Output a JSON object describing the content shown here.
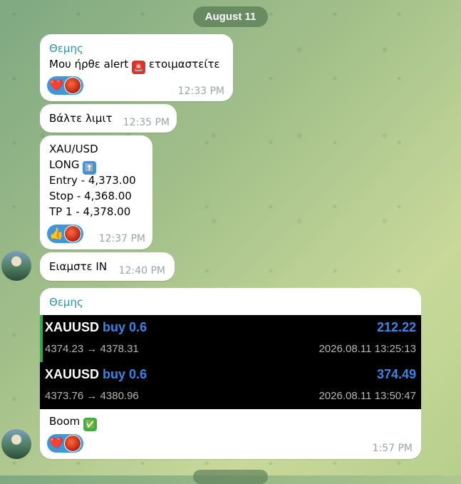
{
  "date_pill": "August 11",
  "messages": {
    "m1": {
      "sender": "Θεμης",
      "text_before": "Μου ήρθε alert",
      "emoji": "🚨",
      "text_after": "ετοιμαστείτε",
      "time": "12:33 PM",
      "reaction": "❤️"
    },
    "m2": {
      "text": "Βάλτε λιμιτ",
      "time": "12:35 PM"
    },
    "m3": {
      "lines": [
        "XAU/USD",
        "LONG",
        "Entry - 4,373.00",
        "Stop - 4,368.00",
        "TP 1 - 4,378.00"
      ],
      "long_emoji": "⬆️",
      "time": "12:37 PM",
      "reaction": "👍"
    },
    "m4": {
      "text": "Ειαμστε IN",
      "time": "12:40 PM"
    },
    "m5": {
      "sender": "Θεμης",
      "trades": [
        {
          "symbol": "XAUUSD",
          "side": "buy 0.6",
          "profit": "212.22",
          "price": "4374.23 → 4378.31",
          "datetime": "2026.08.11 13:25:13"
        },
        {
          "symbol": "XAUUSD",
          "side": "buy 0.6",
          "profit": "374.49",
          "price": "4373.76 → 4380.96",
          "datetime": "2026.08.11 13:50:47"
        }
      ],
      "caption": "Boom",
      "caption_emoji": "✅",
      "time": "1:57 PM",
      "reaction": "❤️"
    }
  },
  "colors": {
    "sender": "#3390a8",
    "reaction_bg": "#3e97d6",
    "profit": "#3a86e6",
    "green_bar": "#2fa94c"
  },
  "icons": {
    "siren": "police-light-icon",
    "arrow_up": "up-arrow-emoji-icon",
    "check": "check-mark-emoji-icon"
  }
}
